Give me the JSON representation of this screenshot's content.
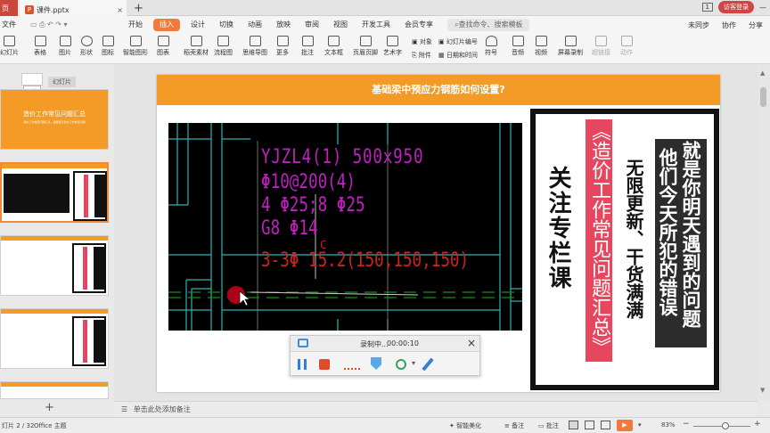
{
  "window": {
    "home_tab": "页",
    "file_tab": "课件.pptx",
    "new_tab": "+",
    "badge": "1",
    "visitor": "访客登录"
  },
  "menu": {
    "file": "文件",
    "items": [
      "开始",
      "插入",
      "设计",
      "切换",
      "动画",
      "放映",
      "审阅",
      "视图",
      "开发工具",
      "会员专享"
    ],
    "active_index": 1,
    "search_placeholder": "查找命令、搜索模板",
    "right": [
      "未同步",
      "协作",
      "分享"
    ]
  },
  "toolbar": {
    "items": [
      "幻灯片",
      "表格",
      "图片",
      "形状",
      "图标",
      "智能图形",
      "图表",
      "稻壳素材",
      "流程图",
      "思维导图",
      "更多",
      "批注",
      "文本框",
      "页眉页脚",
      "艺术字",
      "音频",
      "视频",
      "屏幕录制",
      "超链接",
      "动作"
    ],
    "small": [
      "对象",
      "附件",
      "幻灯片编号",
      "日期和时间",
      "符号"
    ]
  },
  "left_pane": {
    "tab_label": "幻灯片",
    "tooltip": "开始",
    "thumb1_title": "造价工作常见问题汇总",
    "thumb1_sub": "造价工作常见问题汇总，温馨提示造价工作常见问题",
    "add": "+"
  },
  "slide": {
    "title": "基础梁中预应力钢筋如何设置?",
    "cad_lines": [
      "YJZL4(1) 500x950",
      "Φ10@200(4)",
      "4 Φ25;8 Φ25",
      "G8 Φ14",
      "3-3Φ 15.2(150,150,150)"
    ],
    "cad_c": "C",
    "pink_text": "《造价工作常见问题汇总》",
    "mid_text": "无限更新、干货满满",
    "left_text": "关注专栏课",
    "dark_col1": "就是你明天遇到的问题",
    "dark_col2": "他们今天所犯的错误"
  },
  "recorder": {
    "status": "录制中...",
    "time": "00:00:10"
  },
  "notes": {
    "placeholder": "单击此处添加备注"
  },
  "status": {
    "slide": "灯片 2 / 32",
    "theme": "Office 主题",
    "smart": "智能美化",
    "notes": "备注",
    "comment": "批注",
    "zoom": "83%"
  }
}
